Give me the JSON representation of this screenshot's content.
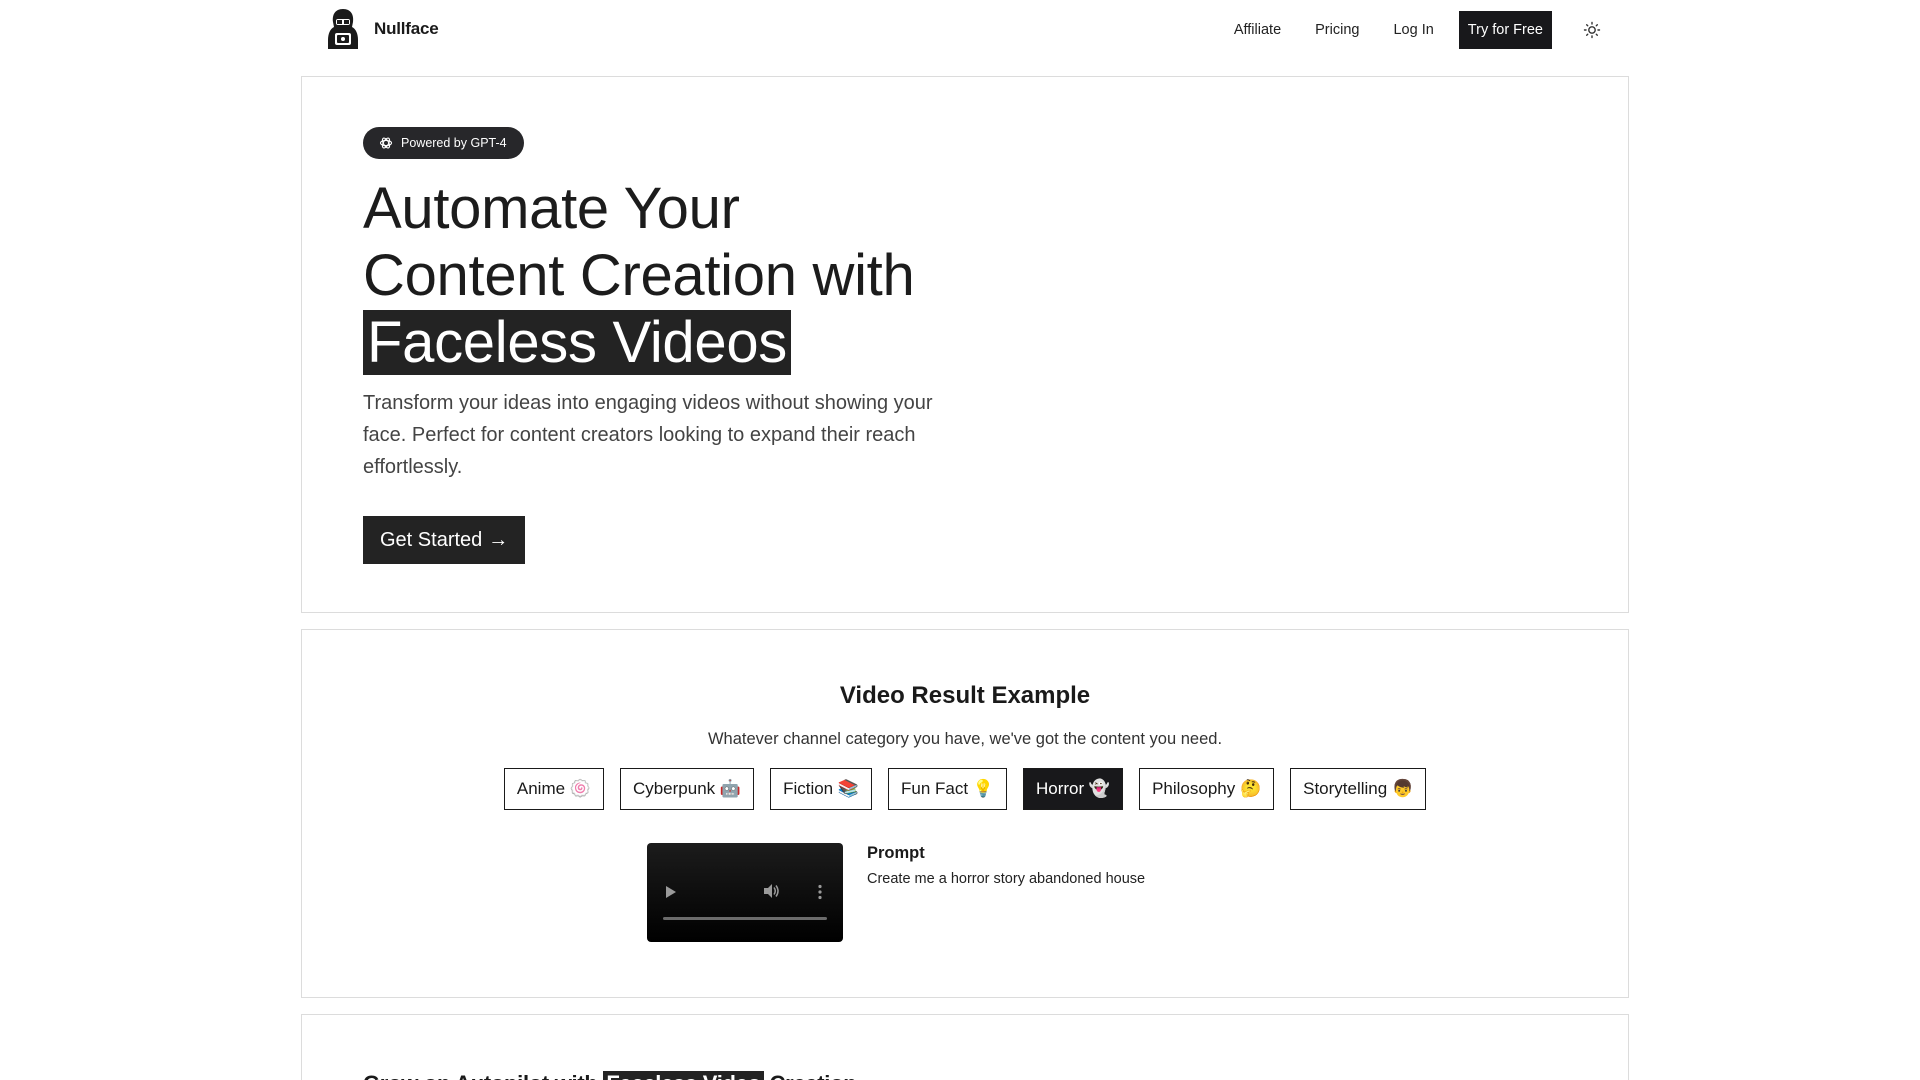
{
  "header": {
    "brand": "Nullface",
    "nav": [
      "Affiliate",
      "Pricing",
      "Log In"
    ],
    "cta": "Try for Free",
    "theme_icon": "sun-icon"
  },
  "hero": {
    "badge": "Powered by GPT-4",
    "badge_icon": "openai-icon",
    "title_line1": "Automate Your",
    "title_line2": "Content Creation with",
    "title_highlight": "Faceless Videos",
    "subtitle": "Transform your ideas into engaging videos without showing your face. Perfect for content creators looking to expand their reach effortlessly.",
    "button": "Get Started",
    "button_arrow": "→"
  },
  "examples": {
    "title": "Video Result Example",
    "subtitle": "Whatever channel category you have, we've got the content you need.",
    "tabs": [
      "Anime 🍥",
      "Cyberpunk 🤖",
      "Fiction 📚",
      "Fun Fact 💡",
      "Horror 👻",
      "Philosophy 🤔",
      "Storytelling 👦"
    ],
    "active_tab": "Horror 👻",
    "prompt_label": "Prompt",
    "prompt_text": "Create me a horror story abandoned house"
  },
  "grow": {
    "title_before": "Grow on Autopilot with",
    "title_highlight": "Faceless Video",
    "title_after": "Creation"
  },
  "colors": {
    "dark": "#18181b",
    "border": "#dcdcdc",
    "text": "#1a1a1a"
  }
}
